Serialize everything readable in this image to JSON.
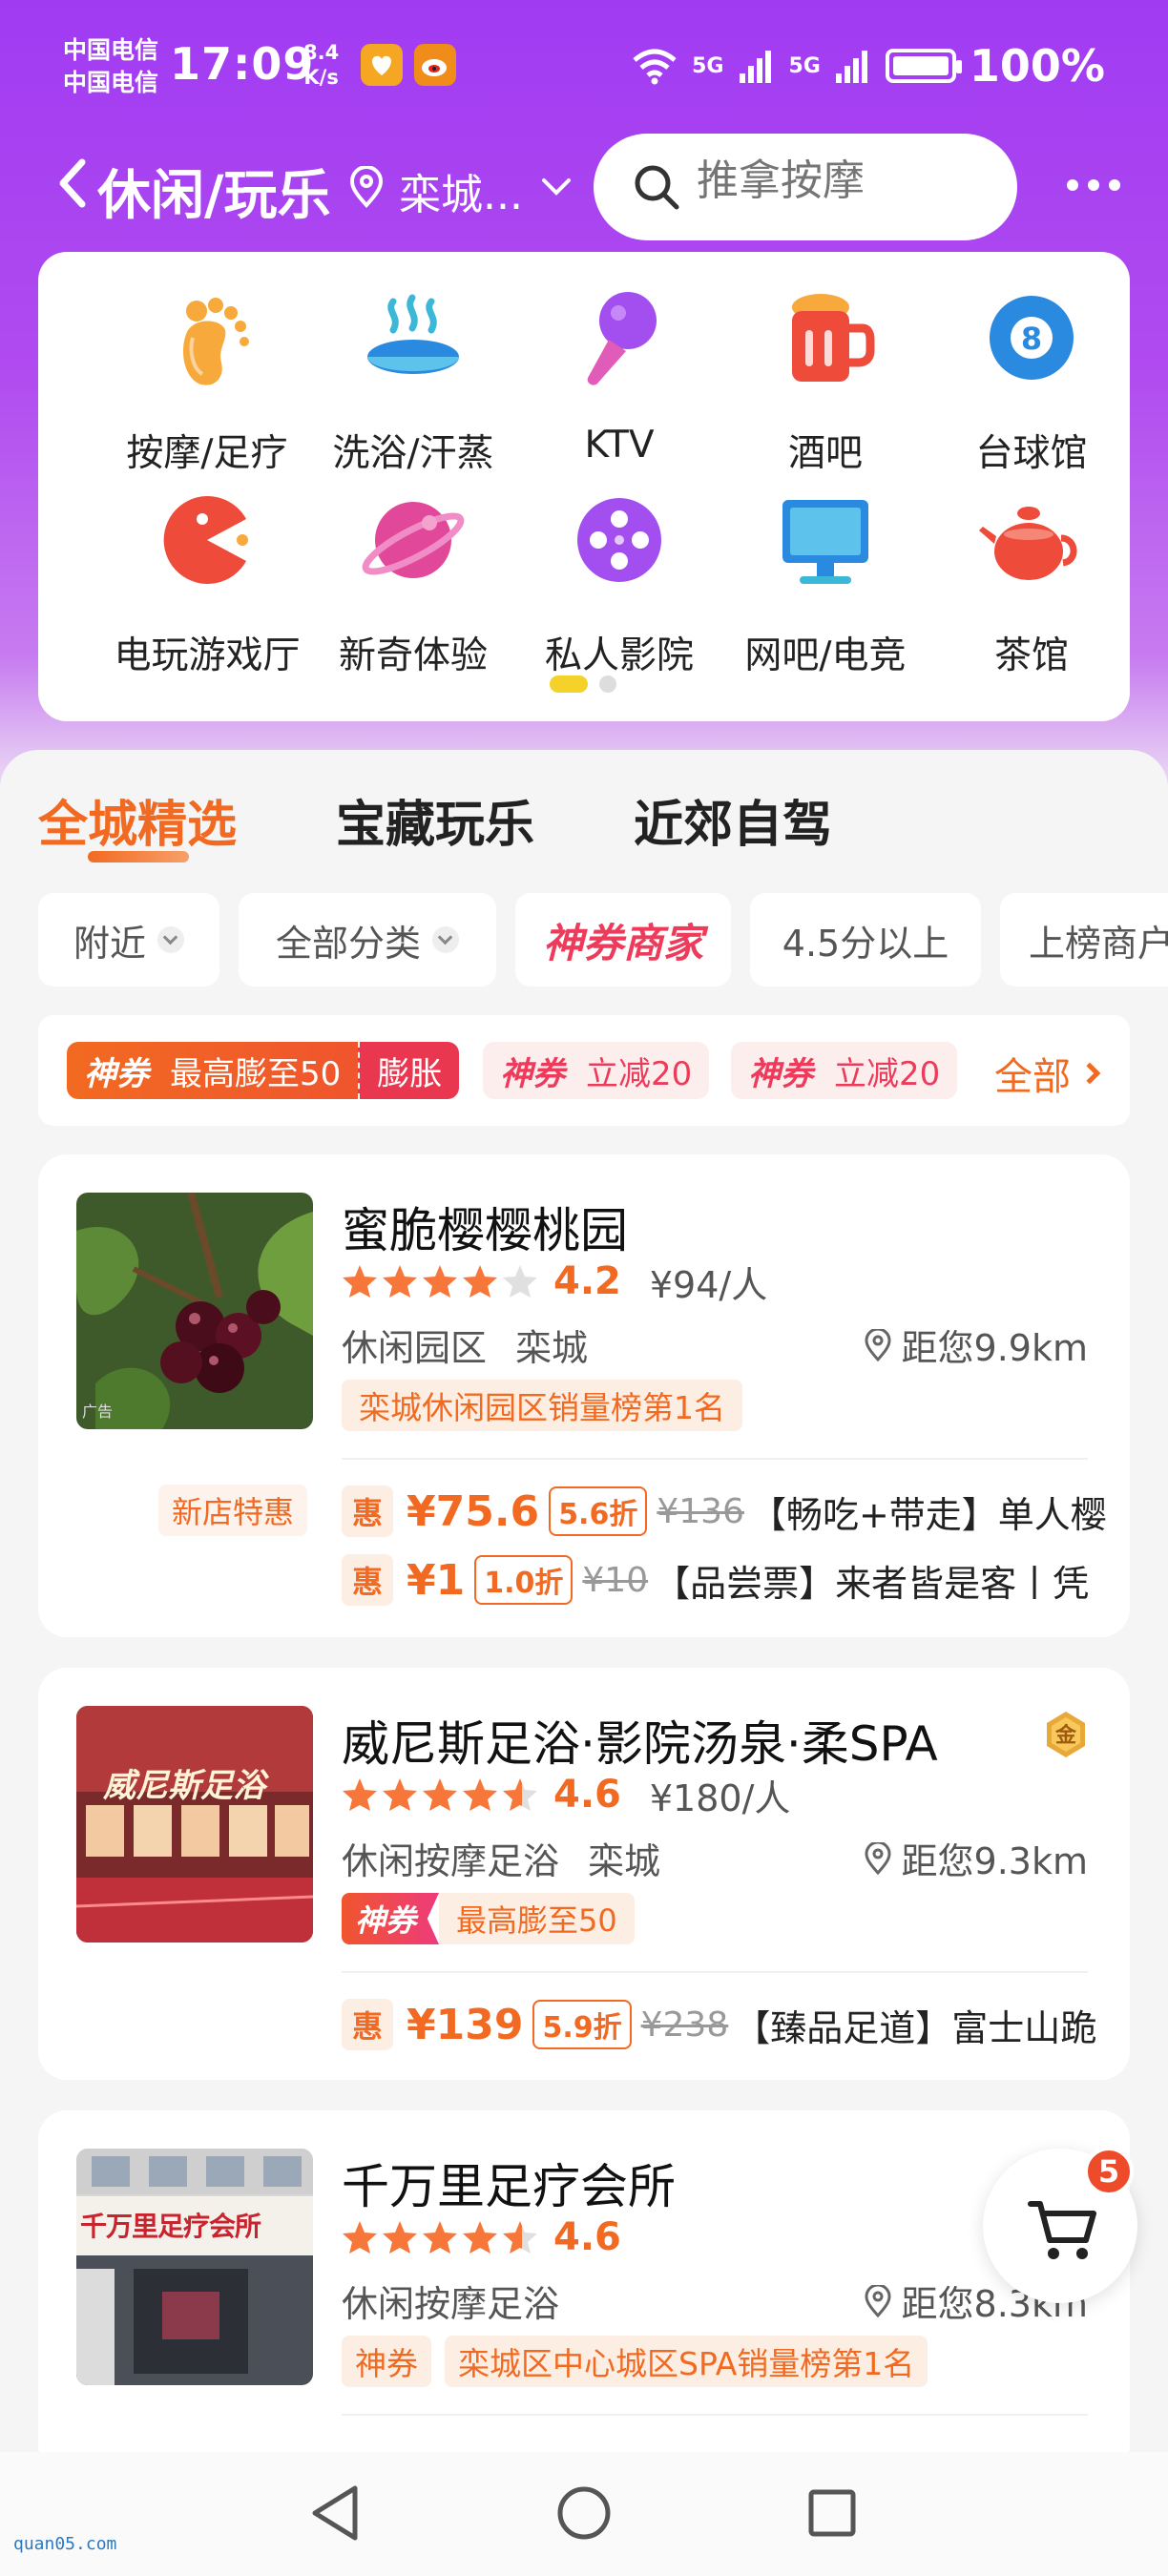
{
  "status_bar": {
    "carrier_1": "中国电信",
    "carrier_2": "中国电信",
    "time": "17:09",
    "speed_value": "8.4",
    "speed_unit": "K/s",
    "signal_1": "5G",
    "signal_2": "5G",
    "battery": "100%"
  },
  "nav": {
    "title": "休闲/玩乐",
    "location": "栾城...",
    "search_placeholder": "推拿按摩"
  },
  "categories": [
    {
      "label": "按摩/足疗",
      "icon": "foot-icon"
    },
    {
      "label": "洗浴/汗蒸",
      "icon": "bath-icon"
    },
    {
      "label": "KTV",
      "icon": "microphone-icon"
    },
    {
      "label": "酒吧",
      "icon": "beer-icon"
    },
    {
      "label": "台球馆",
      "icon": "billiard-ball-icon"
    },
    {
      "label": "电玩游戏厅",
      "icon": "pacman-icon"
    },
    {
      "label": "新奇体验",
      "icon": "planet-icon"
    },
    {
      "label": "私人影院",
      "icon": "film-reel-icon"
    },
    {
      "label": "网吧/电竞",
      "icon": "monitor-icon"
    },
    {
      "label": "茶馆",
      "icon": "teapot-icon"
    }
  ],
  "tabs": [
    "全城精选",
    "宝藏玩乐",
    "近郊自驾"
  ],
  "filters": [
    "附近",
    "全部分类",
    "神券商家",
    "4.5分以上",
    "上榜商户"
  ],
  "vouchers": {
    "v1_tag": "神券",
    "v1_text": "最高膨至50",
    "v1_action": "膨胀",
    "v2_tag": "神券",
    "v2_text": "立减20",
    "v3_tag": "神券",
    "v3_text": "立减20",
    "all": "全部"
  },
  "shops": [
    {
      "name": "蜜脆樱樱桃园",
      "rating": 4.2,
      "score": "4.2",
      "price": "¥94/人",
      "category": "休闲园区",
      "area": "栾城",
      "distance": "距您9.9km",
      "rank": "栾城休闲园区销量榜第1名",
      "ad": "广告",
      "new_tag": "新店特惠",
      "deals": [
        {
          "hui": "惠",
          "price": "¥75.6",
          "discount": "5.6折",
          "orig": "¥136",
          "name": "【畅吃+带走】单人樱"
        },
        {
          "hui": "惠",
          "price": "¥1",
          "discount": "1.0折",
          "orig": "¥10",
          "name": "【品尝票】来者皆是客丨凭"
        }
      ]
    },
    {
      "name": "威尼斯足浴·影院汤泉·柔SPA",
      "rating": 4.6,
      "score": "4.6",
      "price": "¥180/人",
      "category": "休闲按摩足浴",
      "area": "栾城",
      "distance": "距您9.3km",
      "voucher_tag": "神券",
      "voucher_text": "最高膨至50",
      "badge": "金",
      "sign_text": "威尼斯足浴",
      "deals": [
        {
          "hui": "惠",
          "price": "¥139",
          "discount": "5.9折",
          "orig": "¥238",
          "name": "【臻品足道】富士山跪"
        }
      ]
    },
    {
      "name": "千万里足疗会所",
      "rating": 4.6,
      "score": "4.6",
      "category": "休闲按摩足浴",
      "distance": "距您8.3km",
      "tag_1": "神券",
      "tag_2": "栾城区中心城区SPA销量榜第1名",
      "sign_text": "千万里足疗会所"
    }
  ],
  "cart": {
    "count": "5"
  },
  "watermark": "quan05.com"
}
